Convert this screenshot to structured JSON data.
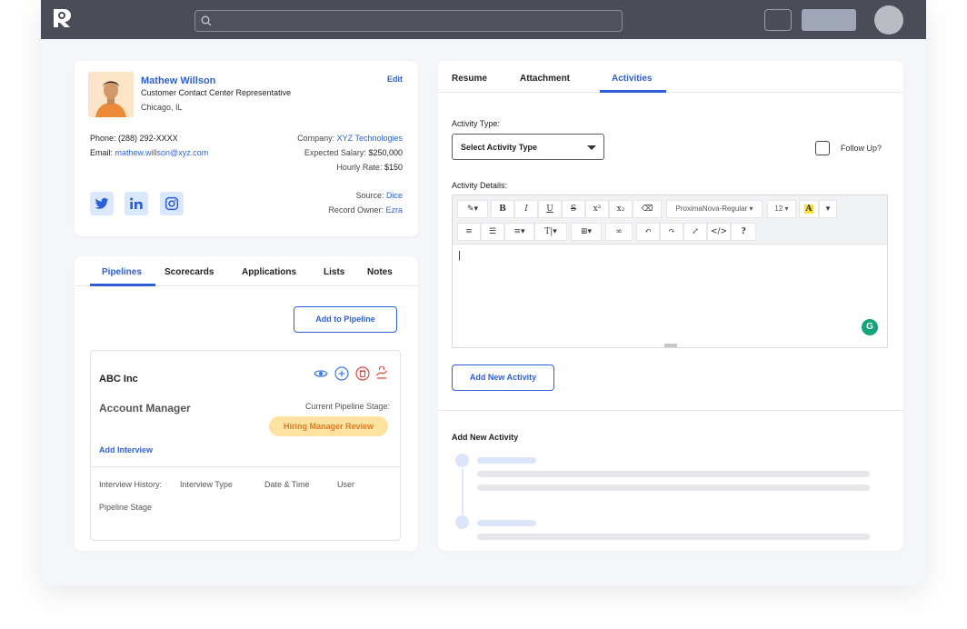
{
  "profile": {
    "name": "Mathew Willson",
    "role": "Customer Contact Center Representative",
    "location": "Chicago, IL",
    "edit_label": "Edit",
    "phone_label": "Phone:",
    "phone": "(288) 292-XXXX",
    "email_label": "Email:",
    "email": "mathew.willson@xyz.com",
    "company_label": "Company:",
    "company": "XYZ Technologies",
    "salary_label": "Expected Salary:",
    "salary": "$250,000",
    "rate_label": "Hourly Rate:",
    "rate": "$150",
    "source_label": "Source:",
    "source": "Dice",
    "owner_label": "Record Owner:",
    "owner": "Ezra",
    "socials": [
      "twitter-icon",
      "linkedin-icon",
      "instagram-icon"
    ]
  },
  "pipeline_card": {
    "tabs": [
      "Pipelines",
      "Scorecards",
      "Applications",
      "Lists",
      "Notes"
    ],
    "active_tab": "Pipelines",
    "add_button": "Add to Pipeline",
    "company": "ABC Inc",
    "position": "Account Manager",
    "stage_label": "Current Pipeline Stage:",
    "stage": "Hiring Manager Review",
    "add_interview": "Add Interview",
    "history_label": "Interview History:",
    "history_cols": [
      "Interview Type",
      "Date & Time",
      "User"
    ],
    "pipeline_stage_label": "Pipeline Stage"
  },
  "activity_card": {
    "tabs": [
      "Resume",
      "Attachment",
      "Activities"
    ],
    "active_tab": "Activities",
    "type_label": "Activity Type:",
    "type_select": "Select Activity Type",
    "follow_up": "Follow Up?",
    "details_label": "Activity Details:",
    "toolbar_font": "ProximaNova-Regular",
    "toolbar_size": "12",
    "add_button": "Add New Activity",
    "timeline_title": "Add New Activity"
  },
  "colors": {
    "accent": "#2d5fd4",
    "topbar": "#4a4d57",
    "badge_bg": "#fde2a1",
    "badge_text": "#e07a1f"
  }
}
